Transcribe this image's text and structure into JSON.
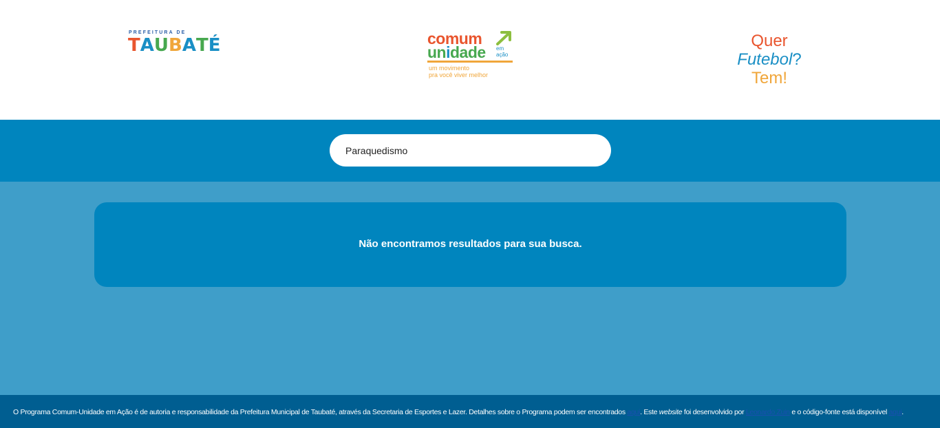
{
  "header": {
    "taubate_logo": {
      "prefix": "PREFEITURA DE",
      "word": [
        "T",
        "A",
        "U",
        "B",
        "A",
        "T",
        "É"
      ],
      "colors": [
        "#e9552e",
        "#1a8fc5",
        "#47a84f",
        "#f0a63a",
        "#1a8fc5",
        "#47a84f",
        "#1a8fc5"
      ]
    },
    "comum_logo": {
      "line1": "comum",
      "line2_a": "un",
      "line2_i": "i",
      "line2_b": "dade",
      "em_acao_1": "em",
      "em_acao_2": "ação",
      "tagline_1": "um movimento",
      "tagline_2": "pra você viver melhor",
      "arrow_color": "#8dbf3f"
    },
    "slogan": {
      "line1": "Quer",
      "line2": "Futebol",
      "line2_q": "?",
      "line3": "Tem!"
    }
  },
  "search": {
    "value": "Paraquedismo"
  },
  "results": {
    "message": "Não encontramos resultados para sua busca."
  },
  "footer": {
    "part1": "O Programa Comum-Unidade em Ação é de autoria e responsabilidade da Prefeitura Municipal de Taubaté, através da Secretaria de Esportes e Lazer. Detalhes sobre o Programa podem ser encontrados ",
    "link1": "aqui",
    "part2": ". Este ",
    "website": "website",
    "part3": " foi desenvolvido por ",
    "link2": "Leonardo Zuin",
    "part4": " e o código-fonte está disponível ",
    "link3": "aqui",
    "part5": "."
  },
  "colors": {
    "header_bg": "#ffffff",
    "search_band": "#0085be",
    "page_bg": "#3f9ec9",
    "card_bg": "#0085be",
    "footer_bg": "#005e91"
  }
}
